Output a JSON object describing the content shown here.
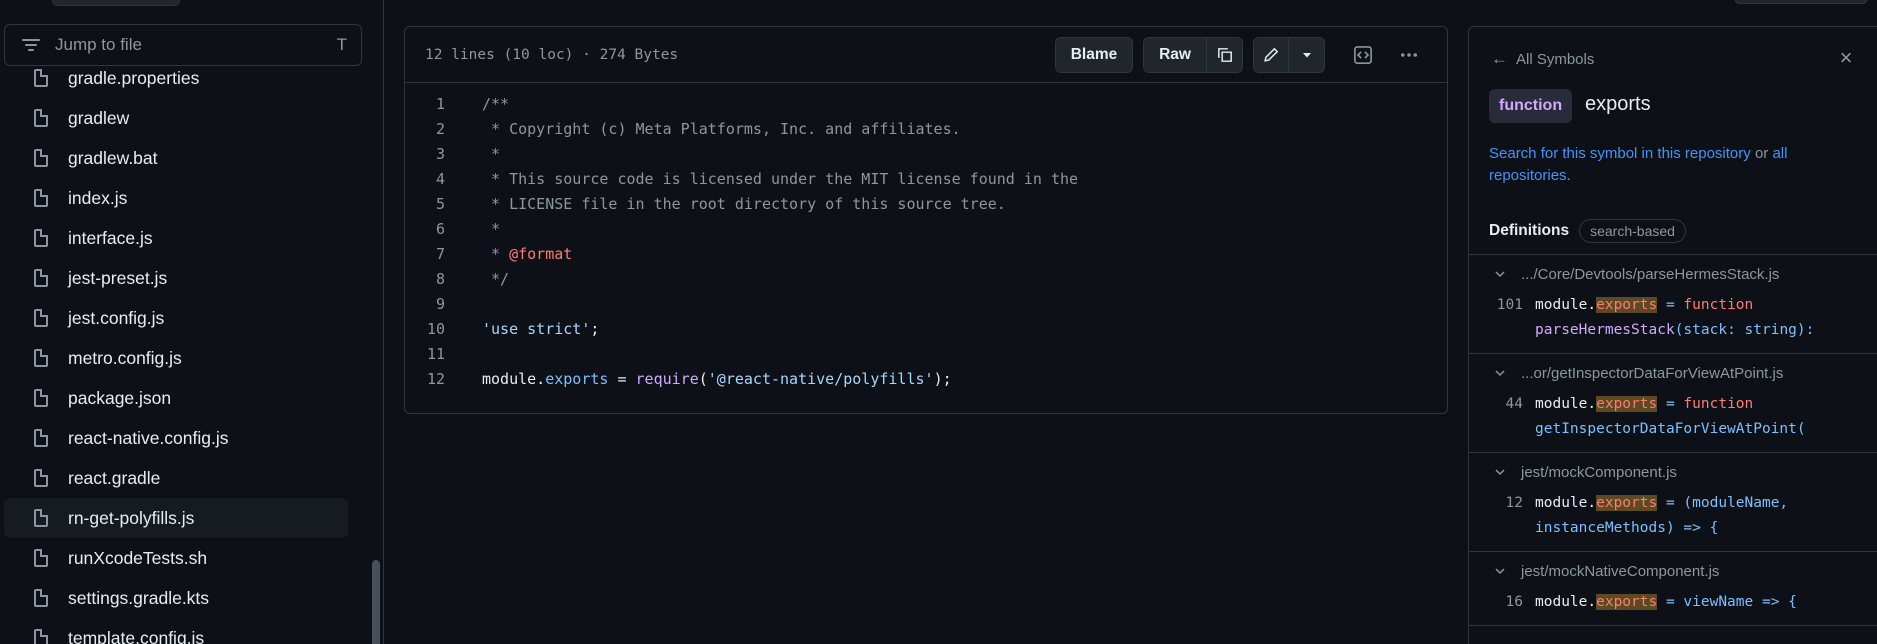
{
  "tree": {
    "search_placeholder": "Jump to file",
    "search_shortcut": "T",
    "files": [
      {
        "name": "gradle.properties",
        "active": false
      },
      {
        "name": "gradlew",
        "active": false
      },
      {
        "name": "gradlew.bat",
        "active": false
      },
      {
        "name": "index.js",
        "active": false
      },
      {
        "name": "interface.js",
        "active": false
      },
      {
        "name": "jest-preset.js",
        "active": false
      },
      {
        "name": "jest.config.js",
        "active": false
      },
      {
        "name": "metro.config.js",
        "active": false
      },
      {
        "name": "package.json",
        "active": false
      },
      {
        "name": "react-native.config.js",
        "active": false
      },
      {
        "name": "react.gradle",
        "active": false
      },
      {
        "name": "rn-get-polyfills.js",
        "active": true
      },
      {
        "name": "runXcodeTests.sh",
        "active": false
      },
      {
        "name": "settings.gradle.kts",
        "active": false
      },
      {
        "name": "template.config.js",
        "active": false
      }
    ]
  },
  "code": {
    "info": "12 lines (10 loc) · 274 Bytes",
    "blame_label": "Blame",
    "raw_label": "Raw",
    "lines": [
      {
        "n": "1",
        "tokens": [
          {
            "t": "/**",
            "c": "comment"
          }
        ]
      },
      {
        "n": "2",
        "tokens": [
          {
            "t": " * Copyright (c) Meta Platforms, Inc. and affiliates.",
            "c": "comment"
          }
        ]
      },
      {
        "n": "3",
        "tokens": [
          {
            "t": " *",
            "c": "comment"
          }
        ]
      },
      {
        "n": "4",
        "tokens": [
          {
            "t": " * This source code is licensed under the MIT license found in the",
            "c": "comment"
          }
        ]
      },
      {
        "n": "5",
        "tokens": [
          {
            "t": " * LICENSE file in the root directory of this source tree.",
            "c": "comment"
          }
        ]
      },
      {
        "n": "6",
        "tokens": [
          {
            "t": " *",
            "c": "comment"
          }
        ]
      },
      {
        "n": "7",
        "tokens": [
          {
            "t": " * ",
            "c": "comment"
          },
          {
            "t": "@format",
            "c": "kw"
          }
        ]
      },
      {
        "n": "8",
        "tokens": [
          {
            "t": " */",
            "c": "comment"
          }
        ]
      },
      {
        "n": "9",
        "tokens": []
      },
      {
        "n": "10",
        "tokens": [
          {
            "t": "'use strict'",
            "c": "str"
          },
          {
            "t": ";",
            "c": "plain"
          }
        ]
      },
      {
        "n": "11",
        "tokens": []
      },
      {
        "n": "12",
        "tokens": [
          {
            "t": "module",
            "c": "plain"
          },
          {
            "t": ".",
            "c": "plain"
          },
          {
            "t": "exports",
            "c": "prop"
          },
          {
            "t": " = ",
            "c": "plain"
          },
          {
            "t": "require",
            "c": "fn"
          },
          {
            "t": "(",
            "c": "plain"
          },
          {
            "t": "'@react-native/polyfills'",
            "c": "str"
          },
          {
            "t": ");",
            "c": "plain"
          }
        ]
      }
    ]
  },
  "symbols": {
    "back_label": "All Symbols",
    "kind": "function",
    "name": "exports",
    "search_prefix": "Search for this symbol in this repository",
    "search_or": " or ",
    "search_all": "all repositories",
    "search_suffix": ".",
    "definitions_title": "Definitions",
    "definitions_chip": "search-based",
    "groups": [
      {
        "path": ".../Core/Devtools/parseHermesStack.js",
        "line": "101",
        "text1": [
          {
            "t": "module.",
            "c": "plain"
          },
          {
            "t": "exports",
            "c": "hl"
          },
          {
            "t": " = ",
            "c": "prop"
          },
          {
            "t": "function",
            "c": "kw"
          }
        ],
        "text2": [
          {
            "t": "parseHermesStack",
            "c": "fn"
          },
          {
            "t": "(stack: string):",
            "c": "prop"
          }
        ]
      },
      {
        "path": "...or/getInspectorDataForViewAtPoint.js",
        "line": "44",
        "text1": [
          {
            "t": "module.",
            "c": "plain"
          },
          {
            "t": "exports",
            "c": "hl"
          },
          {
            "t": " = ",
            "c": "prop"
          },
          {
            "t": "function",
            "c": "kw"
          }
        ],
        "text2": [
          {
            "t": "getInspectorDataForViewAtPoint(",
            "c": "prop"
          }
        ]
      },
      {
        "path": "jest/mockComponent.js",
        "line": "12",
        "text1": [
          {
            "t": "module.",
            "c": "plain"
          },
          {
            "t": "exports",
            "c": "hl"
          },
          {
            "t": " = (moduleName,",
            "c": "prop"
          }
        ],
        "text2": [
          {
            "t": "instanceMethods) => {",
            "c": "prop"
          }
        ]
      },
      {
        "path": "jest/mockNativeComponent.js",
        "line": "16",
        "text1": [
          {
            "t": "module.",
            "c": "plain"
          },
          {
            "t": "exports",
            "c": "hl"
          },
          {
            "t": " = viewName => {",
            "c": "prop"
          }
        ],
        "text2": []
      }
    ]
  },
  "colors": {
    "bg": "#0d1117",
    "border": "#30363d",
    "text": "#e6edf3",
    "muted": "#8d96a0",
    "link": "#4493f8",
    "keyword": "#ff7b72",
    "string": "#a5d6ff",
    "function_purple": "#d2a8ff"
  },
  "icons": [
    "filter-icon",
    "file-icon",
    "copy-icon",
    "pencil-icon",
    "triangle-down-icon",
    "code-square-icon",
    "kebab-horizontal-icon",
    "arrow-left-icon",
    "x-icon",
    "chevron-down-icon"
  ]
}
